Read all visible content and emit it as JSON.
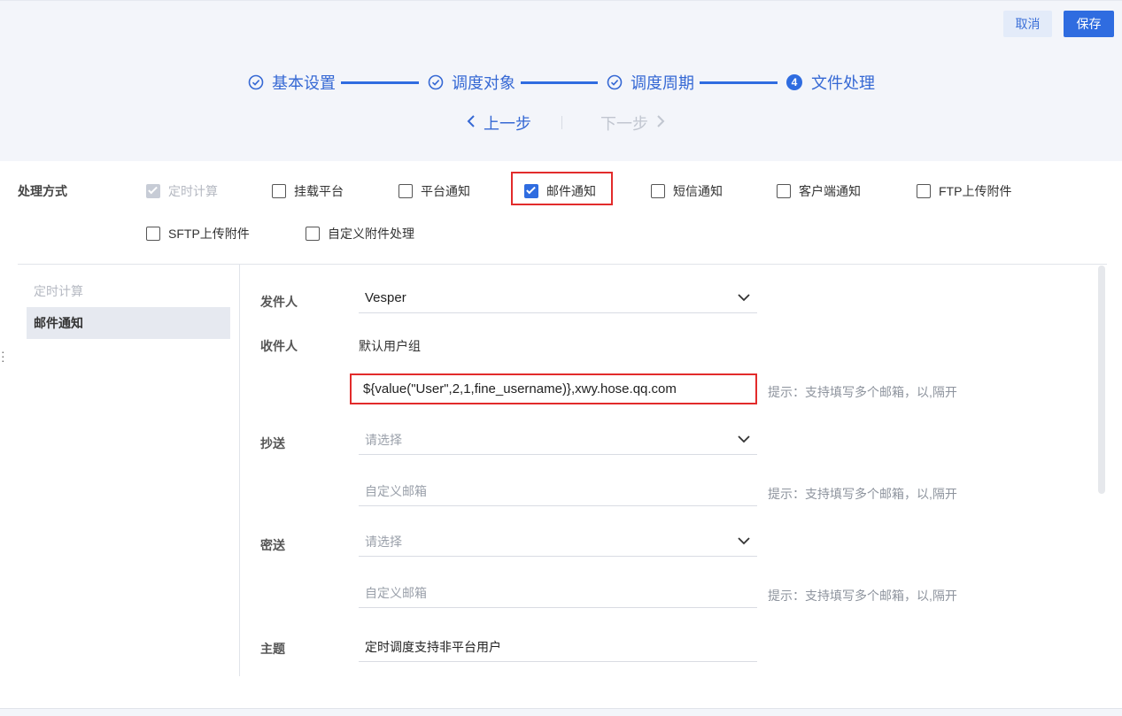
{
  "toolbar": {
    "cancel_label": "取消",
    "save_label": "保存"
  },
  "steps": [
    {
      "label": "基本设置",
      "state": "done"
    },
    {
      "label": "调度对象",
      "state": "done"
    },
    {
      "label": "调度周期",
      "state": "done"
    },
    {
      "label": "文件处理",
      "state": "current",
      "number": "4"
    }
  ],
  "nav": {
    "prev_label": "上一步",
    "next_label": "下一步"
  },
  "method": {
    "label": "处理方式",
    "options": [
      {
        "label": "定时计算",
        "checked": true,
        "disabled": true
      },
      {
        "label": "挂载平台",
        "checked": false
      },
      {
        "label": "平台通知",
        "checked": false
      },
      {
        "label": "邮件通知",
        "checked": true
      },
      {
        "label": "短信通知",
        "checked": false
      },
      {
        "label": "客户端通知",
        "checked": false
      },
      {
        "label": "FTP上传附件",
        "checked": false
      },
      {
        "label": "SFTP上传附件",
        "checked": false
      },
      {
        "label": "自定义附件处理",
        "checked": false
      }
    ]
  },
  "subnav": {
    "items": [
      "定时计算",
      "邮件通知"
    ]
  },
  "form": {
    "sender_label": "发件人",
    "sender_value": "Vesper",
    "recipient_label": "收件人",
    "recipient_group": "默认用户组",
    "recipient_custom_value": "${value(\"User\",2,1,fine_username)},xwy.hose.qq.com",
    "hint": "提示：支持填写多个邮箱，以,隔开",
    "cc_label": "抄送",
    "select_placeholder": "请选择",
    "custom_email_placeholder": "自定义邮箱",
    "bcc_label": "密送",
    "subject_label": "主题",
    "subject_value": "定时调度支持非平台用户"
  },
  "colors": {
    "accent": "#2f6ce0",
    "highlight": "#e22b2b"
  }
}
